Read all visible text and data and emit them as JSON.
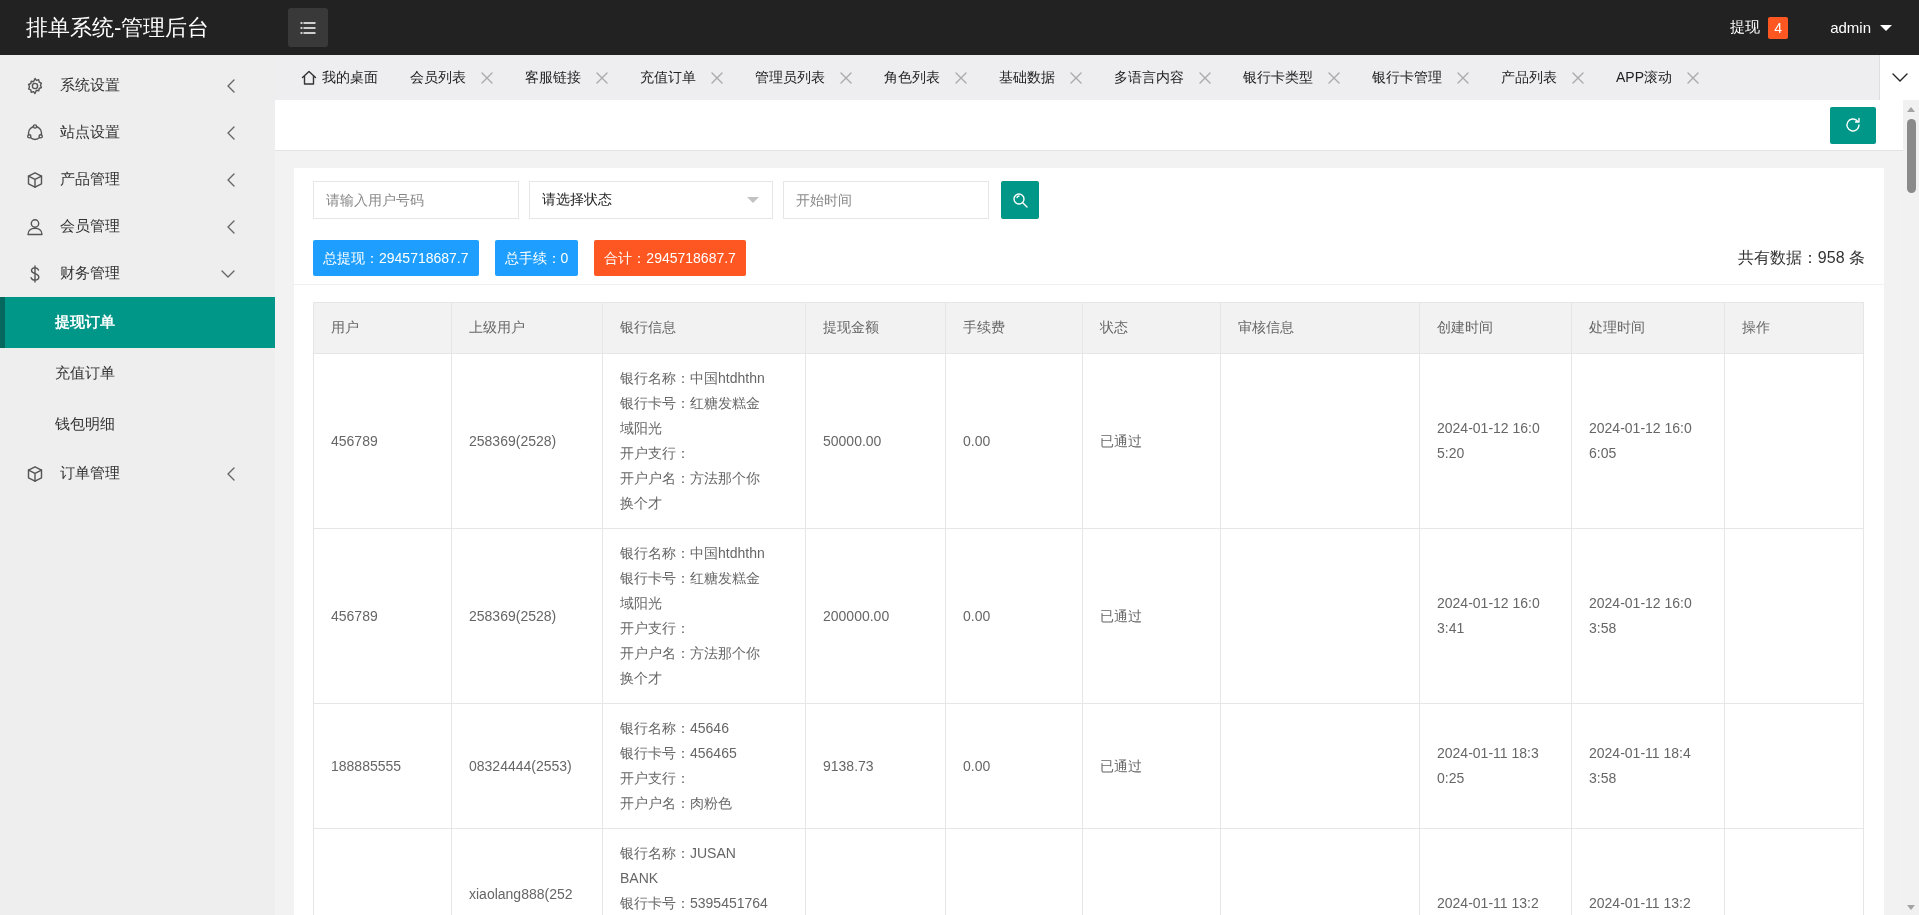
{
  "header": {
    "title": "排单系统-管理后台",
    "notice": {
      "label": "提现",
      "badge": "4"
    },
    "user": "admin"
  },
  "sidebar": {
    "items": [
      {
        "label": "系统设置",
        "kind": "gear",
        "expanded": false
      },
      {
        "label": "站点设置",
        "kind": "network",
        "expanded": false
      },
      {
        "label": "产品管理",
        "kind": "cube",
        "expanded": false
      },
      {
        "label": "会员管理",
        "kind": "person",
        "expanded": false
      },
      {
        "label": "财务管理",
        "kind": "dollar",
        "expanded": true,
        "children": [
          {
            "label": "提现订单",
            "selected": true
          },
          {
            "label": "充值订单",
            "selected": false
          },
          {
            "label": "钱包明细",
            "selected": false
          }
        ]
      },
      {
        "label": "订单管理",
        "kind": "cube",
        "expanded": false
      }
    ]
  },
  "tabs": [
    {
      "label": "我的桌面",
      "kind": "home"
    },
    {
      "label": "会员列表",
      "kind": "closable"
    },
    {
      "label": "客服链接",
      "kind": "closable"
    },
    {
      "label": "充值订单",
      "kind": "closable"
    },
    {
      "label": "管理员列表",
      "kind": "closable"
    },
    {
      "label": "角色列表",
      "kind": "closable"
    },
    {
      "label": "基础数据",
      "kind": "closable"
    },
    {
      "label": "多语言内容",
      "kind": "closable"
    },
    {
      "label": "银行卡类型",
      "kind": "closable"
    },
    {
      "label": "银行卡管理",
      "kind": "closable"
    },
    {
      "label": "产品列表",
      "kind": "closable"
    },
    {
      "label": "APP滚动",
      "kind": "closable"
    }
  ],
  "filters": {
    "user_placeholder": "请输入用户号码",
    "status_select": "请选择状态",
    "date_placeholder": "开始时间"
  },
  "stats": [
    {
      "label": "总提现：2945718687.7",
      "color": "#1e9fff"
    },
    {
      "label": "总手续：0",
      "color": "#1e9fff"
    },
    {
      "label": "合计：2945718687.7",
      "color": "#ff5722"
    }
  ],
  "total": "共有数据：958 条",
  "table": {
    "columns": [
      "用户",
      "上级用户",
      "银行信息",
      "提现金额",
      "手续费",
      "状态",
      "审核信息",
      "创建时间",
      "处理时间",
      "操作"
    ],
    "rows": [
      {
        "cut": false,
        "user": "456789",
        "parent": "258369(2528)",
        "bank": [
          "银行名称：中国htdhthn",
          "银行卡号：红糖发糕金域阳光",
          "开户支行：",
          "开户户名：方法那个你换个才"
        ],
        "amount": "50000.00",
        "fee": "0.00",
        "status": "已通过",
        "created": "2024-01-12 16:05:20",
        "processed": "2024-01-12 16:06:05"
      },
      {
        "cut": false,
        "user": "456789",
        "parent": "258369(2528)",
        "bank": [
          "银行名称：中国htdhthn",
          "银行卡号：红糖发糕金域阳光",
          "开户支行：",
          "开户户名：方法那个你换个才"
        ],
        "amount": "200000.00",
        "fee": "0.00",
        "status": "已通过",
        "created": "2024-01-12 16:03:41",
        "processed": "2024-01-12 16:03:58"
      },
      {
        "cut": false,
        "user": "188885555",
        "parent": "08324444(2553)",
        "bank": [
          "银行名称：45646",
          "银行卡号：456465",
          "开户支行：",
          "开户户名：肉粉色"
        ],
        "amount": "9138.73",
        "fee": "0.00",
        "status": "已通过",
        "created": "2024-01-11 18:30:25",
        "processed": "2024-01-11 18:43:58"
      },
      {
        "cut": true,
        "parent": "xiaolang888(252",
        "bank": [
          "银行名称：JUSAN BANK",
          "银行卡号：5395451764"
        ],
        "created": "2024-01-11 13:2",
        "processed": "2024-01-11 13:2"
      }
    ]
  }
}
